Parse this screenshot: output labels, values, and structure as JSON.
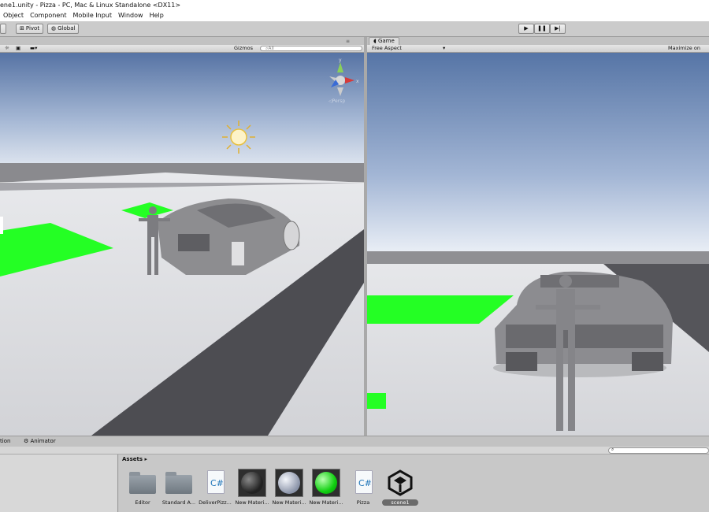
{
  "window": {
    "title": "ene1.unity - Pizza - PC, Mac & Linux Standalone <DX11>"
  },
  "menu": [
    "Object",
    "Component",
    "Mobile Input",
    "Window",
    "Help"
  ],
  "toolbar": {
    "pivot": "Pivot",
    "global": "Global"
  },
  "scene": {
    "gizmos": "Gizmos",
    "search_placeholder": "All",
    "persp": "Persp"
  },
  "game": {
    "tab": "Game",
    "aspect": "Free Aspect",
    "maximize": "Maximize on Pla"
  },
  "bottom": {
    "tab1": "tion",
    "tab2": "Animator"
  },
  "assets": {
    "header": "Assets",
    "items": [
      {
        "label": "Editor",
        "kind": "folder"
      },
      {
        "label": "Standard A...",
        "kind": "folder"
      },
      {
        "label": "DeliverPizz...",
        "kind": "script"
      },
      {
        "label": "New Materi...",
        "kind": "material-dark"
      },
      {
        "label": "New Materi...",
        "kind": "material-grey"
      },
      {
        "label": "New Materi...",
        "kind": "material-green"
      },
      {
        "label": "Pizza",
        "kind": "script"
      },
      {
        "label": "scene1",
        "kind": "unity-scene",
        "selected": true
      }
    ]
  },
  "colors": {
    "green": "#24ff24",
    "sky_top": "#5b7aa8",
    "sky_horizon": "#e9eef6",
    "ground": "#dcdde0",
    "road": "#4a4a4f"
  }
}
